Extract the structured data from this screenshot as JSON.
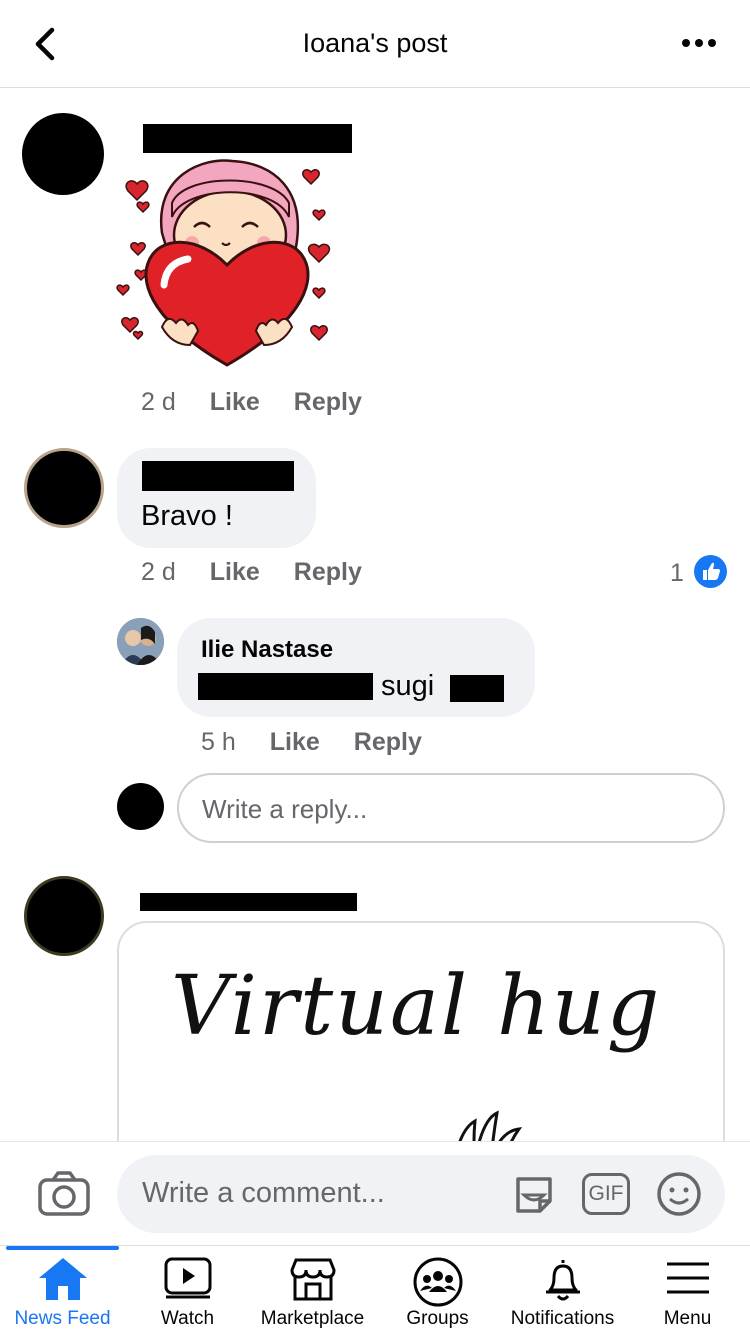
{
  "header": {
    "title": "Ioana's post"
  },
  "comments": [
    {
      "timestamp": "2 d",
      "like_label": "Like",
      "reply_label": "Reply"
    },
    {
      "text": "Bravo !",
      "timestamp": "2 d",
      "like_label": "Like",
      "reply_label": "Reply",
      "reaction_count": "1",
      "reply": {
        "author": "Ilie Nastase",
        "text": "sugi",
        "timestamp": "5 h",
        "like_label": "Like",
        "reply_label": "Reply"
      },
      "reply_placeholder": "Write a reply..."
    },
    {
      "attachment_text": "Virtual hug"
    }
  ],
  "composer": {
    "placeholder": "Write a comment...",
    "gif_label": "GIF"
  },
  "tabs": [
    {
      "label": "News Feed",
      "active": true
    },
    {
      "label": "Watch"
    },
    {
      "label": "Marketplace"
    },
    {
      "label": "Groups"
    },
    {
      "label": "Notifications"
    },
    {
      "label": "Menu"
    }
  ],
  "colors": {
    "accent": "#1877f2",
    "secondary_text": "#65676b",
    "bubble": "#f0f2f5"
  }
}
